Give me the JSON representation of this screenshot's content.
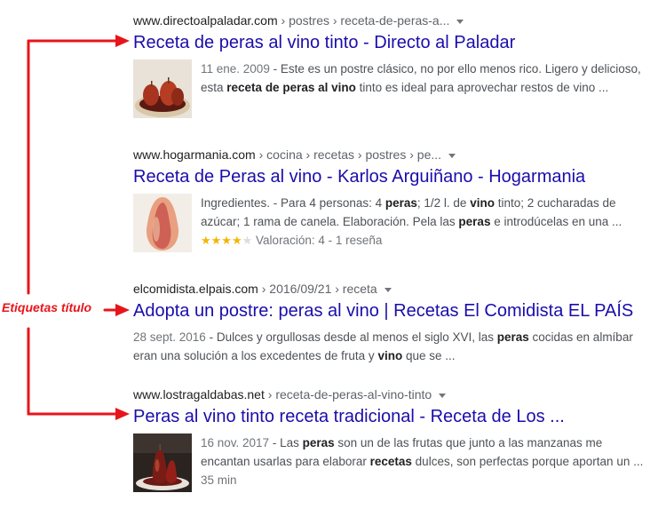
{
  "annotation": {
    "label": "Etiquetas título",
    "color": "#e8141b"
  },
  "results": [
    {
      "domain": "www.directoalpaladar.com",
      "path": " › postres › receta-de-peras-a...",
      "title": "Receta de peras al vino tinto - Directo al Paladar",
      "date": "11 ene. 2009",
      "line1_pre": " - Este es un postre clásico, no por ello menos rico. Ligero y delicioso,",
      "line2_pre": "esta ",
      "line2_bold": "receta de peras al vino",
      "line2_post": " tinto es ideal para aprovechar restos de vino ..."
    },
    {
      "domain": "www.hogarmania.com",
      "path": " › cocina › recetas › postres › pe...",
      "title": "Receta de Peras al vino - Karlos Arguiñano - Hogarmania",
      "line1_a": "Ingredientes. - Para 4 personas: 4 ",
      "line1_b": "peras",
      "line1_c": "; 1/2 l. de ",
      "line1_d": "vino",
      "line1_e": " tinto; 2 cucharadas de",
      "line2_a": "azúcar; 1 rama de canela. Elaboración. Pela las ",
      "line2_b": "peras",
      "line2_c": " e introdúcelas en una ...",
      "rating_text": "Valoración: 4 - 1 reseña",
      "rating_value": 4,
      "rating_max": 5
    },
    {
      "domain": "elcomidista.elpais.com",
      "path": " › 2016/09/21 › receta",
      "title": "Adopta un postre: peras al vino | Recetas El Comidista EL PAÍS",
      "date": "28 sept. 2016",
      "line1_a": " - Dulces y orgullosas desde al menos el siglo XVI, las ",
      "line1_b": "peras",
      "line1_c": " cocidas en almíbar",
      "line2_a": "eran una solución a los excedentes de fruta y ",
      "line2_b": "vino",
      "line2_c": " que se ..."
    },
    {
      "domain": "www.lostragaldabas.net",
      "path": " › receta-de-peras-al-vino-tinto",
      "title": "Peras al vino tinto receta tradicional - Receta de Los ...",
      "date": "16 nov. 2017",
      "line1_a": " - Las ",
      "line1_b": "peras",
      "line1_c": " son un de las frutas que junto a las manzanas me",
      "line2_a": "encantan usarlas para elaborar ",
      "line2_b": "recetas",
      "line2_c": " dulces, son perfectas porque aportan un ...",
      "line3": "35 min"
    }
  ]
}
